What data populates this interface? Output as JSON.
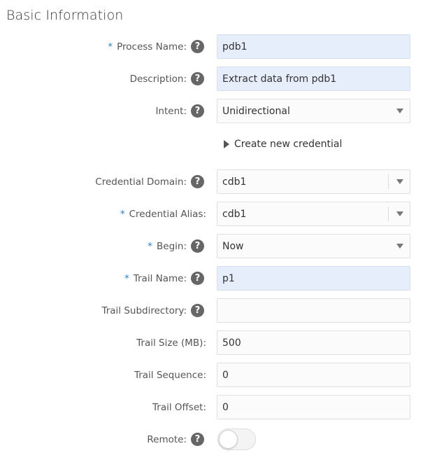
{
  "section_title": "Basic Information",
  "create_credential_label": "Create new credential",
  "help_glyph": "?",
  "fields": {
    "process_name": {
      "required": "*",
      "label": "Process Name:",
      "value": "pdb1"
    },
    "description": {
      "label": "Description:",
      "value": "Extract data from pdb1"
    },
    "intent": {
      "label": "Intent:",
      "value": "Unidirectional"
    },
    "credential_domain": {
      "label": "Credential Domain:",
      "value": "cdb1"
    },
    "credential_alias": {
      "required": "*",
      "label": "Credential Alias:",
      "value": "cdb1"
    },
    "begin": {
      "required": "*",
      "label": "Begin:",
      "value": "Now"
    },
    "trail_name": {
      "required": "*",
      "label": "Trail Name:",
      "value": "p1"
    },
    "trail_subdirectory": {
      "label": "Trail Subdirectory:",
      "value": ""
    },
    "trail_size": {
      "label": "Trail Size (MB):",
      "value": "500"
    },
    "trail_sequence": {
      "label": "Trail Sequence:",
      "value": "0"
    },
    "trail_offset": {
      "label": "Trail Offset:",
      "value": "0"
    },
    "remote": {
      "label": "Remote:",
      "enabled": false
    }
  },
  "colors": {
    "filled_input_bg": "#e6edfb",
    "required_marker": "#2a7ec0",
    "help_icon_bg": "#666666"
  },
  "icons": {
    "help": "question-circle-icon",
    "dropdown": "caret-down-icon",
    "expand": "caret-right-icon"
  }
}
